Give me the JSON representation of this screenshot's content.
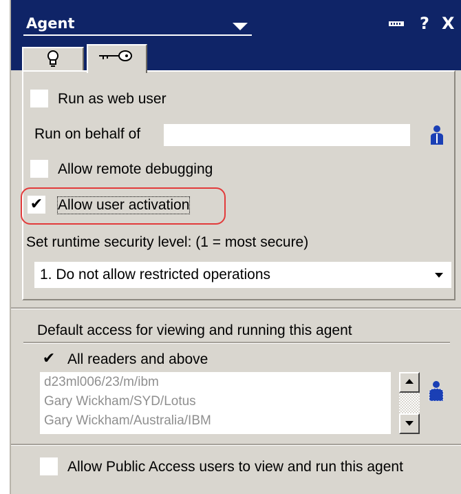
{
  "window": {
    "title": "Agent"
  },
  "tabs": [
    {
      "icon": "lightbulb-icon"
    },
    {
      "icon": "key-icon",
      "active": true
    }
  ],
  "security": {
    "run_as_web_user": {
      "label": "Run as web user",
      "checked": false
    },
    "run_on_behalf_of": {
      "label": "Run on behalf of",
      "value": ""
    },
    "allow_remote_debugging": {
      "label": "Allow remote debugging",
      "checked": false
    },
    "allow_user_activation": {
      "label": "Allow user activation",
      "checked": true
    },
    "runtime_security": {
      "label": "Set runtime security level: (1 = most secure)",
      "selected": "1. Do not allow restricted operations"
    }
  },
  "access": {
    "heading": "Default access for viewing and running this agent",
    "all_readers": {
      "label": "All readers and above",
      "checked": true
    },
    "readers": [
      "d23ml006/23/m/ibm",
      "Gary Wickham/SYD/Lotus",
      "Gary Wickham/Australia/IBM"
    ]
  },
  "public_access": {
    "label": "Allow Public Access users to view and run this agent",
    "checked": false
  },
  "check_glyph": "✔",
  "colors": {
    "title_bar": "#0f2467",
    "panel": "#d9d6cf",
    "highlight": "#e23a3a",
    "person_icon": "#1a3fb5",
    "disabled_text": "#8f8f8f"
  }
}
